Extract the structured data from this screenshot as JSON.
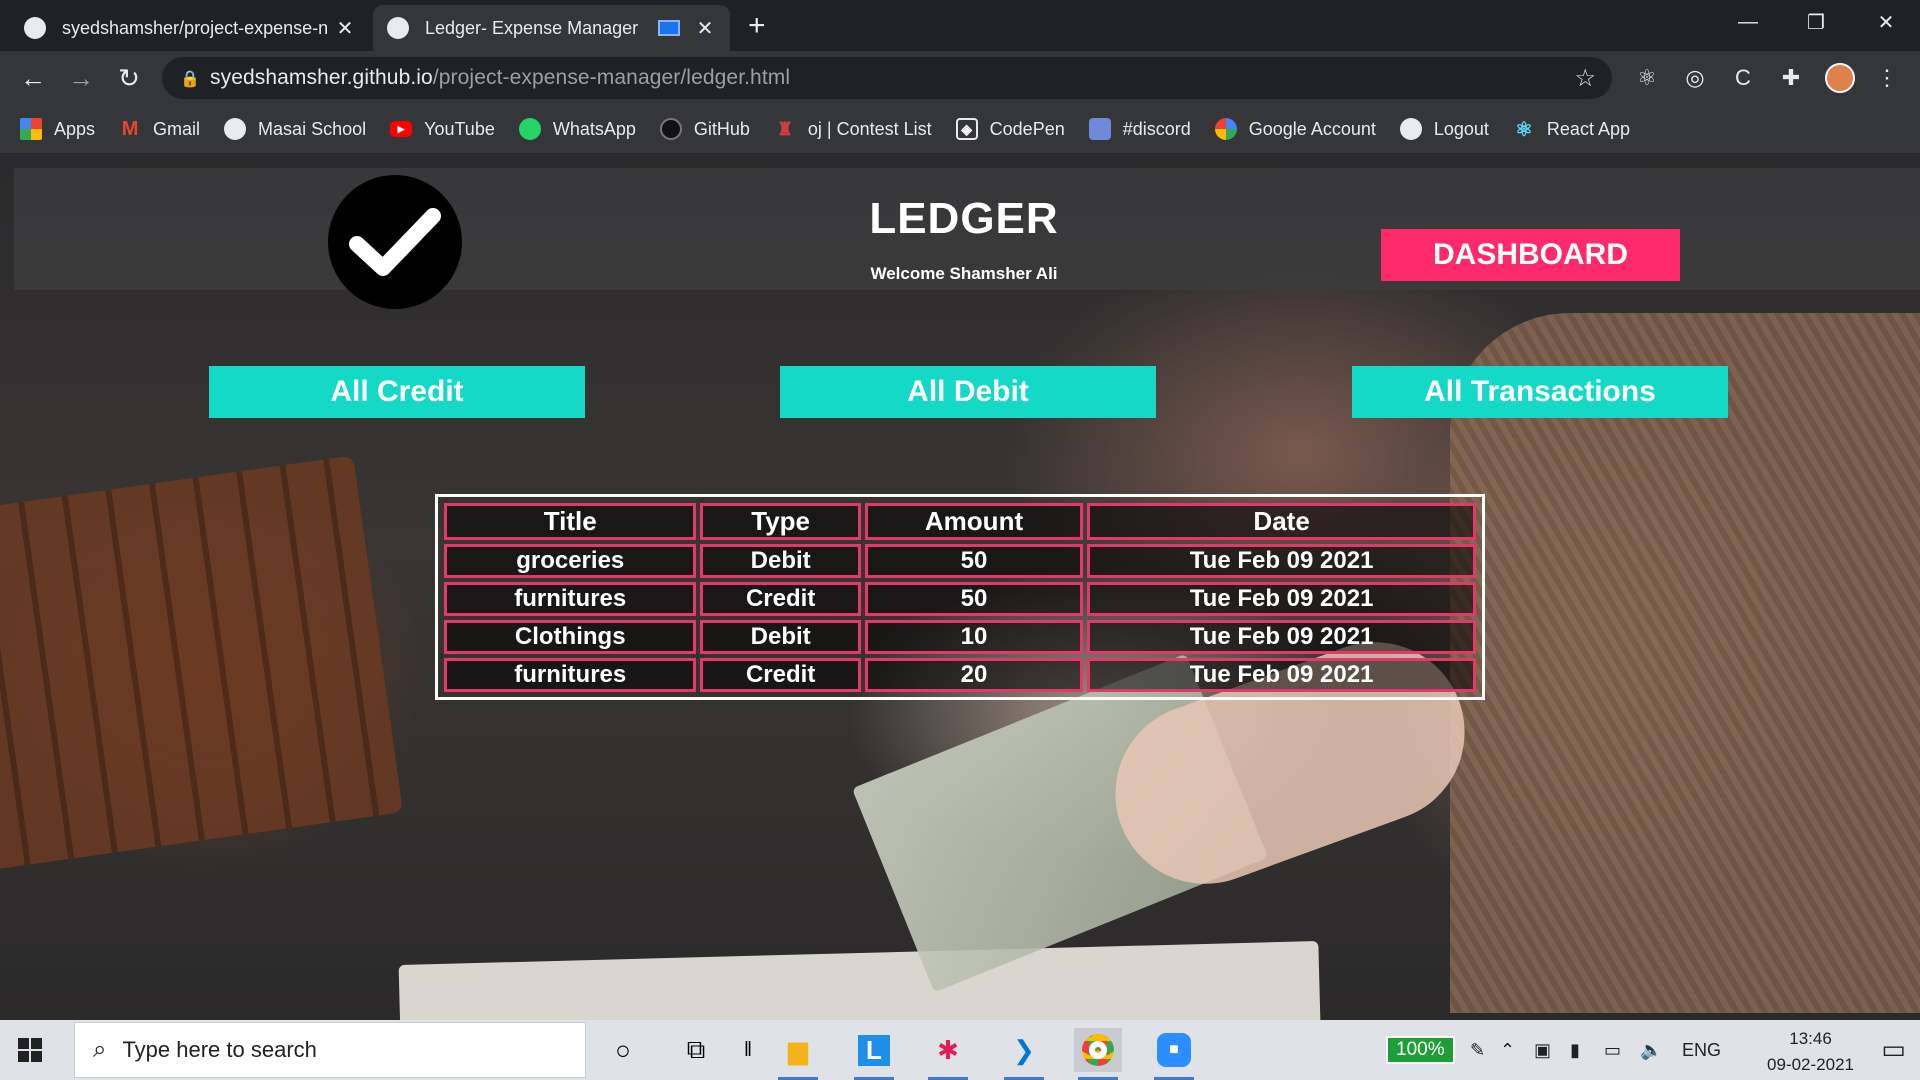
{
  "browser": {
    "tabs": [
      {
        "title": "syedshamsher/project-expense-n",
        "active": false
      },
      {
        "title": "Ledger- Expense Manager",
        "active": true
      }
    ],
    "new_tab": "+",
    "url_domain": "syedshamsher.github.io",
    "url_path": "/project-expense-manager/ledger.html",
    "bookmarks": [
      {
        "label": "Apps",
        "icon": "apps-grid-icon"
      },
      {
        "label": "Gmail",
        "icon": "gmail-icon"
      },
      {
        "label": "Masai School",
        "icon": "globe-icon"
      },
      {
        "label": "YouTube",
        "icon": "youtube-icon"
      },
      {
        "label": "WhatsApp",
        "icon": "whatsapp-icon"
      },
      {
        "label": "GitHub",
        "icon": "github-icon"
      },
      {
        "label": "oj | Contest List",
        "icon": "trophy-icon"
      },
      {
        "label": "CodePen",
        "icon": "codepen-icon"
      },
      {
        "label": "#discord",
        "icon": "discord-icon"
      },
      {
        "label": "Google Account",
        "icon": "google-icon"
      },
      {
        "label": "Logout",
        "icon": "globe-icon"
      },
      {
        "label": "React App",
        "icon": "react-icon"
      }
    ]
  },
  "page": {
    "title": "LEDGER",
    "welcome": "Welcome Shamsher Ali",
    "dashboard_button": "DASHBOARD",
    "filters": [
      "All Credit",
      "All Debit",
      "All Transactions"
    ],
    "table": {
      "headers": [
        "Title",
        "Type",
        "Amount",
        "Date"
      ],
      "rows": [
        [
          "groceries",
          "Debit",
          "50",
          "Tue Feb 09 2021"
        ],
        [
          "furnitures",
          "Credit",
          "50",
          "Tue Feb 09 2021"
        ],
        [
          "Clothings",
          "Debit",
          "10",
          "Tue Feb 09 2021"
        ],
        [
          "furnitures",
          "Credit",
          "20",
          "Tue Feb 09 2021"
        ]
      ]
    },
    "colors": {
      "accent_pink": "#ff2a6b",
      "accent_teal": "#14d9c7",
      "table_border": "#e4386a"
    }
  },
  "taskbar": {
    "search_placeholder": "Type here to search",
    "battery": "100%",
    "language": "ENG",
    "time": "13:46",
    "date": "09-02-2021"
  }
}
